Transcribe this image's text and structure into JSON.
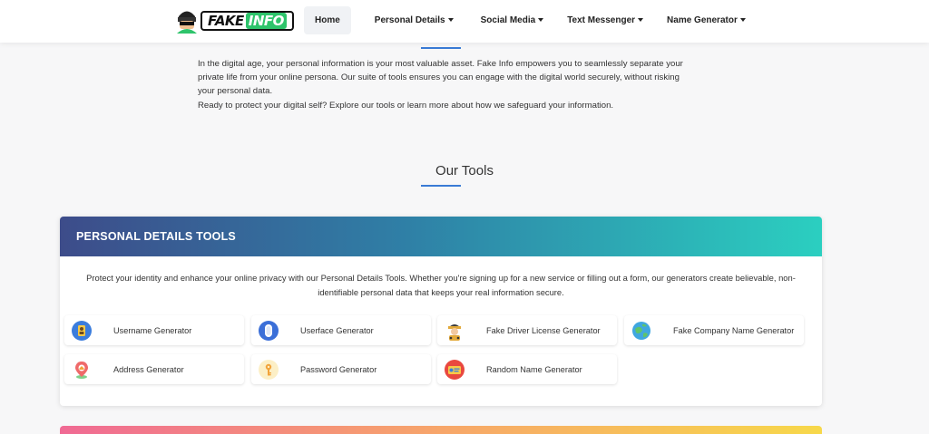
{
  "brand": {
    "part1": "FAKE",
    "part2": "INFO"
  },
  "nav": {
    "home": "Home",
    "personal_details": "Personal Details",
    "social_media": "Social Media",
    "text_messenger": "Text Messenger",
    "name_generator": "Name Generator"
  },
  "intro": {
    "paragraph": "In the digital age, your personal information is your most valuable asset. Fake Info empowers you to seamlessly separate your private life from your online persona. Our suite of tools ensures you can engage with the digital world securely, without risking your personal data.",
    "cta": "Ready to protect your digital self? Explore our tools or learn more about how we safeguard your information."
  },
  "tools_section": {
    "title": "Our Tools"
  },
  "personal_details_card": {
    "title": "PERSONAL DETAILS TOOLS",
    "description": "Protect your identity and enhance your online privacy with our Personal Details Tools. Whether you're signing up for a new service or filling out a form, our generators create believable, non-identifiable personal data that keeps your real information secure.",
    "tools": [
      {
        "label": "Username Generator",
        "icon": "username-icon"
      },
      {
        "label": "Userface Generator",
        "icon": "userface-icon"
      },
      {
        "label": "Fake Driver License Generator",
        "icon": "driver-license-icon"
      },
      {
        "label": "Fake Company Name Generator",
        "icon": "company-globe-icon"
      },
      {
        "label": "Address Generator",
        "icon": "address-pin-icon"
      },
      {
        "label": "Password Generator",
        "icon": "password-key-icon"
      },
      {
        "label": "Random Name Generator",
        "icon": "name-card-icon"
      }
    ]
  },
  "colors": {
    "accent": "#3a7bd5",
    "header_gradient_start": "#3d4c8a",
    "header_gradient_end": "#2bcfc0"
  }
}
